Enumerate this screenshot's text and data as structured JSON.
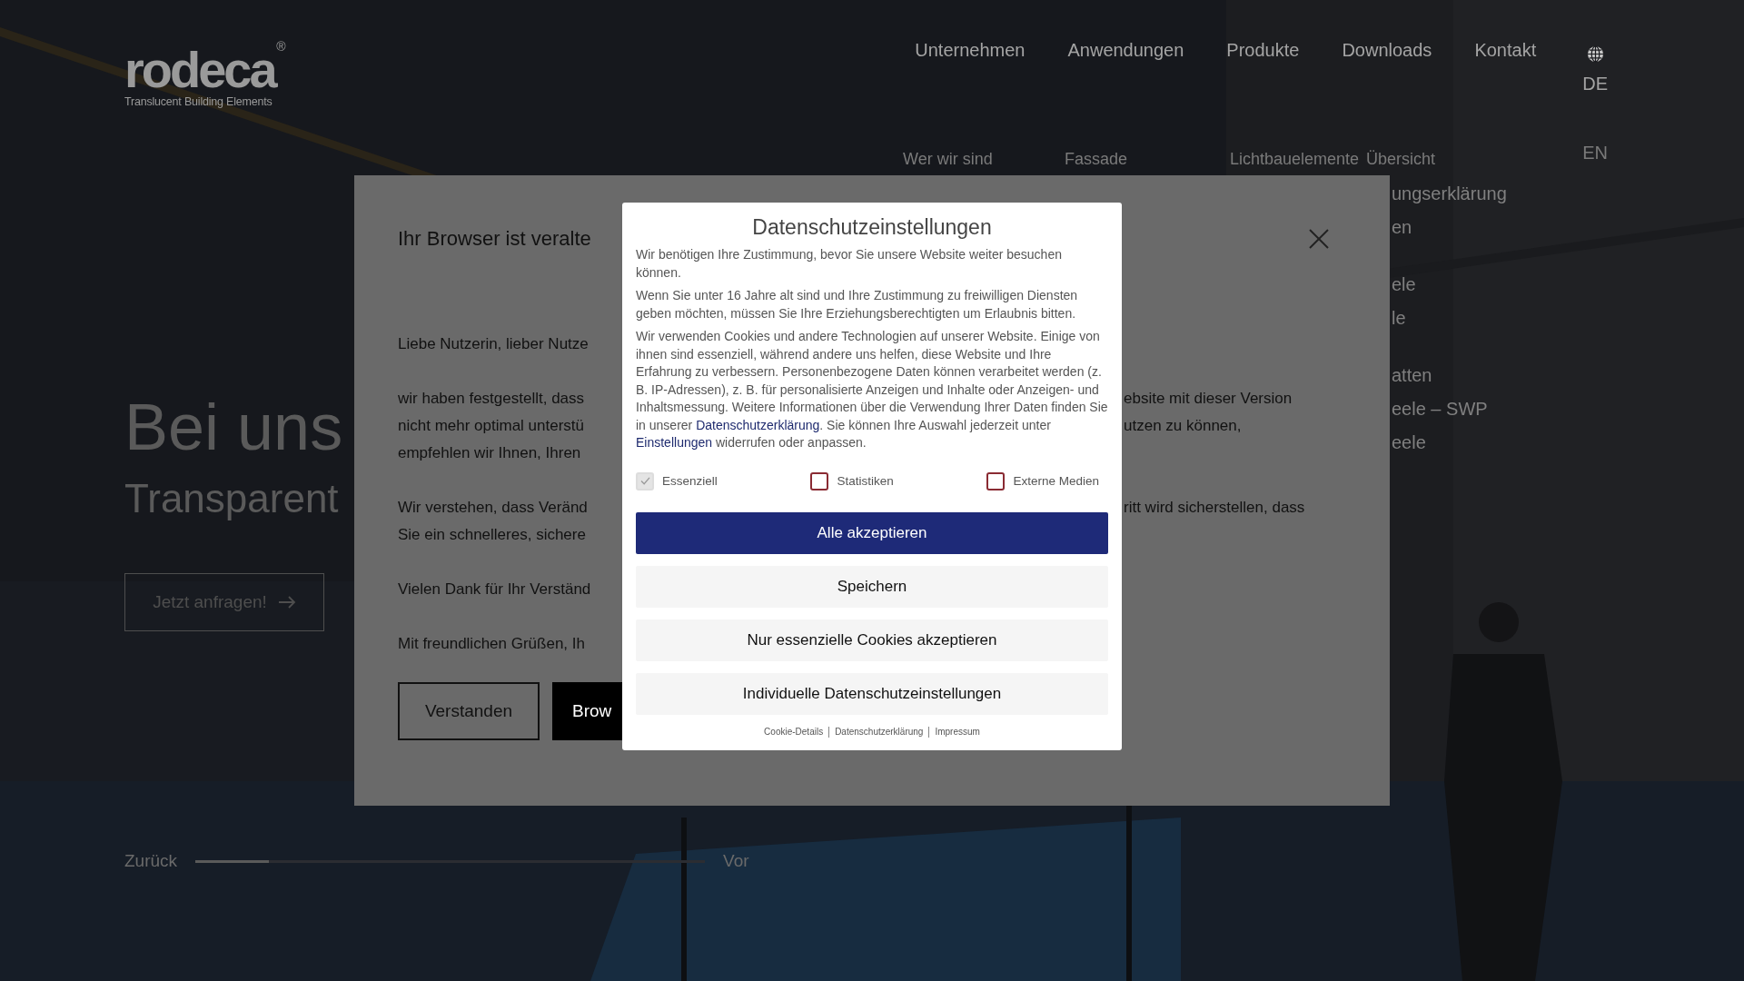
{
  "header": {
    "logo": {
      "wordmark": "rodeca",
      "registered": "®",
      "tagline": "Translucent Building Elements"
    },
    "nav": [
      {
        "label": "Unternehmen"
      },
      {
        "label": "Anwendungen"
      },
      {
        "label": "Produkte"
      },
      {
        "label": "Downloads"
      },
      {
        "label": "Kontakt"
      }
    ],
    "languages": [
      {
        "label": "DE",
        "selected": true
      },
      {
        "label": "EN",
        "selected": false
      }
    ]
  },
  "dropdown": {
    "columns": [
      {
        "items": [
          "Wer wir sind"
        ]
      },
      {
        "items": [
          "Fassade"
        ]
      },
      {
        "items": [
          "Lichtbauelemente"
        ]
      },
      {
        "items": [
          "Übersicht"
        ]
      }
    ],
    "partly_hidden_items": [
      [
        "ungserklärung",
        "en"
      ],
      [
        "ele",
        "le"
      ],
      [
        "atten",
        "eele – SWP",
        "eele"
      ]
    ]
  },
  "hero": {
    "title": "Bei uns",
    "subtitle": "Transparent",
    "button": "Jetzt anfragen!"
  },
  "slider": {
    "prev": "Zurück",
    "next": "Vor",
    "level": 0.145
  },
  "browser_notice": {
    "title": "Ihr Browser ist veralte",
    "paragraphs": [
      [
        {
          "left": "Liebe Nutzerin, lieber Nutze"
        }
      ],
      [
        {
          "left": "wir haben festgestellt, dass",
          "right": "ebsite mit dieser Version"
        },
        {
          "left": "nicht mehr optimal unterstü",
          "right": "utzen zu können,"
        },
        {
          "left": "empfehlen wir Ihnen, Ihren"
        }
      ],
      [
        {
          "left": "Wir verstehen, dass Veränd",
          "right": "ritt wird sicherstellen, dass"
        },
        {
          "left": "Sie ein schnelleres, sichere"
        }
      ],
      [
        {
          "left": "Vielen Dank für Ihr Verständ"
        }
      ],
      [
        {
          "left": "Mit freundlichen Grüßen, Ih"
        }
      ]
    ],
    "buttons": [
      {
        "label": "Verstanden",
        "kind": "outline"
      },
      {
        "label": "Brow",
        "kind": "filled"
      }
    ]
  },
  "cookie_dialog": {
    "title": "Datenschutzeinstellungen",
    "paragraphs": [
      [
        {
          "text": "Wir benötigen Ihre Zustimmung, bevor Sie unsere Website weiter besuchen können."
        }
      ],
      [
        {
          "text": "Wenn Sie unter 16 Jahre alt sind und Ihre Zustimmung zu freiwilligen Diensten geben möchten, müssen Sie Ihre Erziehungsberechtigten um Erlaubnis bitten."
        }
      ],
      [
        {
          "text": "Wir verwenden Cookies und andere Technologien auf unserer Website. Einige von ihnen sind essenziell, während andere uns helfen, diese Website und Ihre Erfahrung zu verbessern. Personenbezogene Daten können verarbeitet werden (z. B. IP-Adressen), z. B. für personalisierte Anzeigen und Inhalte oder Anzeigen- und Inhaltsmessung. Weitere Informationen über die Verwendung Ihrer Daten finden Sie in unserer "
        },
        {
          "text": "Datenschutzerklärung",
          "kind": "link"
        },
        {
          "text": ". Sie können Ihre Auswahl jederzeit unter "
        },
        {
          "text": "Einstellungen",
          "kind": "link"
        },
        {
          "text": " widerrufen oder anpassen."
        }
      ]
    ],
    "checkboxes": [
      {
        "label": "Essenziell",
        "checked": true,
        "disabled": true
      },
      {
        "label": "Statistiken",
        "checked": false,
        "disabled": false
      },
      {
        "label": "Externe Medien",
        "checked": false,
        "disabled": false
      }
    ],
    "buttons": [
      {
        "label": "Alle akzeptieren",
        "kind": "primary"
      },
      {
        "label": "Speichern",
        "kind": "secondary"
      },
      {
        "label": "Nur essenzielle Cookies akzeptieren",
        "kind": "secondary"
      },
      {
        "label": "Individuelle Datenschutzeinstellungen",
        "kind": "secondary"
      }
    ],
    "footer_links": [
      "Cookie-Details",
      "Datenschutzerklärung",
      "Impressum"
    ]
  }
}
